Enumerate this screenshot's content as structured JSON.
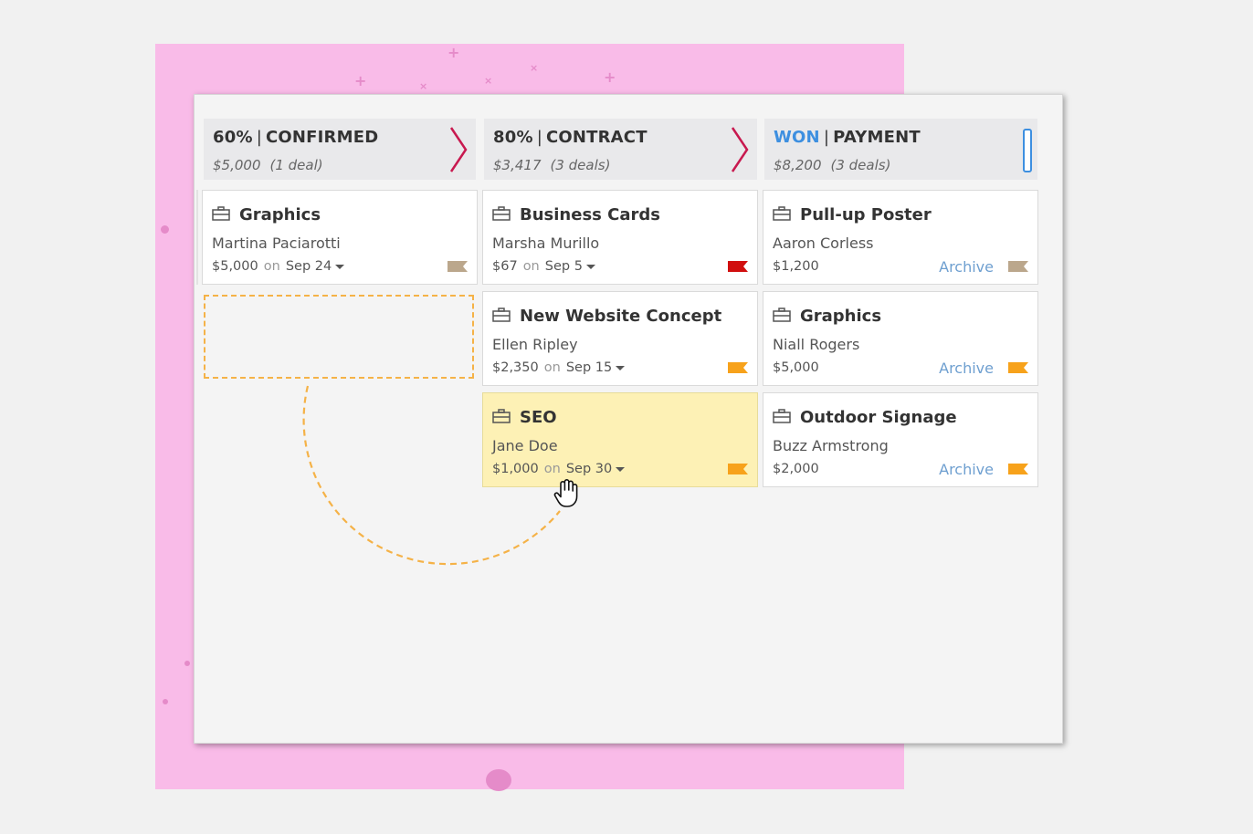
{
  "columns": [
    {
      "percent": "60%",
      "stage": "CONFIRMED",
      "amount": "$5,000",
      "count": "(1 deal)",
      "won": false,
      "cards": [
        {
          "name": "Graphics",
          "person": "Martina Paciarotti",
          "amount": "$5,000",
          "on": "on",
          "date": "Sep 24",
          "archive": "",
          "flag_color": "#bba78c",
          "highlight": false
        }
      ]
    },
    {
      "percent": "80%",
      "stage": "CONTRACT",
      "amount": "$3,417",
      "count": "(3 deals)",
      "won": false,
      "cards": [
        {
          "name": "Business Cards",
          "person": "Marsha Murillo",
          "amount": "$67",
          "on": "on",
          "date": "Sep 5",
          "archive": "",
          "flag_color": "#d10f0f",
          "highlight": false
        },
        {
          "name": "New Website Concept",
          "person": "Ellen Ripley",
          "amount": "$2,350",
          "on": "on",
          "date": "Sep 15",
          "archive": "",
          "flag_color": "#f7a21b",
          "highlight": false
        },
        {
          "name": "SEO",
          "person": "Jane Doe",
          "amount": "$1,000",
          "on": "on",
          "date": "Sep 30",
          "archive": "",
          "flag_color": "#f7a21b",
          "highlight": true
        }
      ]
    },
    {
      "percent": "WON",
      "stage": "PAYMENT",
      "amount": "$8,200",
      "count": "(3 deals)",
      "won": true,
      "cards": [
        {
          "name": "Pull-up Poster",
          "person": "Aaron Corless",
          "amount": "$1,200",
          "on": "",
          "date": "",
          "archive": "Archive",
          "flag_color": "#bba78c",
          "highlight": false
        },
        {
          "name": "Graphics",
          "person": "Niall Rogers",
          "amount": "$5,000",
          "on": "",
          "date": "",
          "archive": "Archive",
          "flag_color": "#f7a21b",
          "highlight": false
        },
        {
          "name": "Outdoor Signage",
          "person": "Buzz Armstrong",
          "amount": "$2,000",
          "on": "",
          "date": "",
          "archive": "Archive",
          "flag_color": "#f7a21b",
          "highlight": false
        }
      ]
    }
  ],
  "colors": {
    "accent_chevron": "#c8194f",
    "won_blue": "#3d8fe0",
    "drop_placeholder": "#f5b247",
    "background_pink": "#f9bbe8"
  },
  "icons": {
    "card": "briefcase-icon",
    "next_stage": "chevron-right-icon",
    "cursor": "hand-grab-cursor-icon"
  }
}
